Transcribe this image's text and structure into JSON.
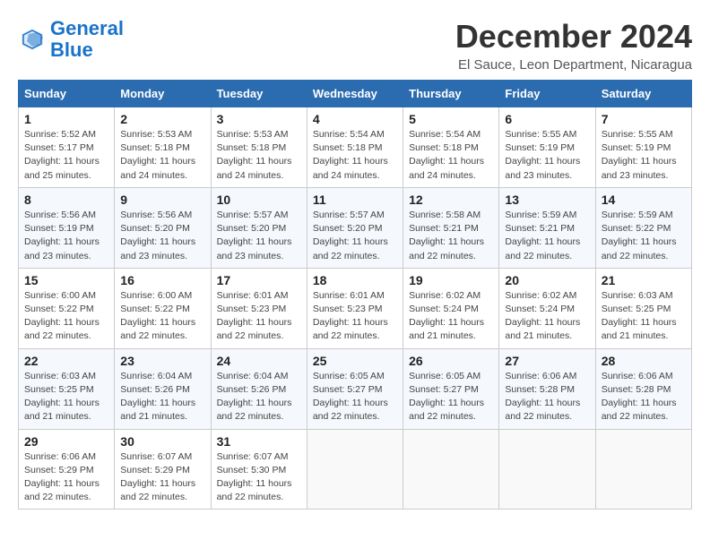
{
  "logo": {
    "line1": "General",
    "line2": "Blue"
  },
  "title": "December 2024",
  "subtitle": "El Sauce, Leon Department, Nicaragua",
  "days_of_week": [
    "Sunday",
    "Monday",
    "Tuesday",
    "Wednesday",
    "Thursday",
    "Friday",
    "Saturday"
  ],
  "weeks": [
    [
      {
        "day": "1",
        "detail": "Sunrise: 5:52 AM\nSunset: 5:17 PM\nDaylight: 11 hours\nand 25 minutes."
      },
      {
        "day": "2",
        "detail": "Sunrise: 5:53 AM\nSunset: 5:18 PM\nDaylight: 11 hours\nand 24 minutes."
      },
      {
        "day": "3",
        "detail": "Sunrise: 5:53 AM\nSunset: 5:18 PM\nDaylight: 11 hours\nand 24 minutes."
      },
      {
        "day": "4",
        "detail": "Sunrise: 5:54 AM\nSunset: 5:18 PM\nDaylight: 11 hours\nand 24 minutes."
      },
      {
        "day": "5",
        "detail": "Sunrise: 5:54 AM\nSunset: 5:18 PM\nDaylight: 11 hours\nand 24 minutes."
      },
      {
        "day": "6",
        "detail": "Sunrise: 5:55 AM\nSunset: 5:19 PM\nDaylight: 11 hours\nand 23 minutes."
      },
      {
        "day": "7",
        "detail": "Sunrise: 5:55 AM\nSunset: 5:19 PM\nDaylight: 11 hours\nand 23 minutes."
      }
    ],
    [
      {
        "day": "8",
        "detail": "Sunrise: 5:56 AM\nSunset: 5:19 PM\nDaylight: 11 hours\nand 23 minutes."
      },
      {
        "day": "9",
        "detail": "Sunrise: 5:56 AM\nSunset: 5:20 PM\nDaylight: 11 hours\nand 23 minutes."
      },
      {
        "day": "10",
        "detail": "Sunrise: 5:57 AM\nSunset: 5:20 PM\nDaylight: 11 hours\nand 23 minutes."
      },
      {
        "day": "11",
        "detail": "Sunrise: 5:57 AM\nSunset: 5:20 PM\nDaylight: 11 hours\nand 22 minutes."
      },
      {
        "day": "12",
        "detail": "Sunrise: 5:58 AM\nSunset: 5:21 PM\nDaylight: 11 hours\nand 22 minutes."
      },
      {
        "day": "13",
        "detail": "Sunrise: 5:59 AM\nSunset: 5:21 PM\nDaylight: 11 hours\nand 22 minutes."
      },
      {
        "day": "14",
        "detail": "Sunrise: 5:59 AM\nSunset: 5:22 PM\nDaylight: 11 hours\nand 22 minutes."
      }
    ],
    [
      {
        "day": "15",
        "detail": "Sunrise: 6:00 AM\nSunset: 5:22 PM\nDaylight: 11 hours\nand 22 minutes."
      },
      {
        "day": "16",
        "detail": "Sunrise: 6:00 AM\nSunset: 5:22 PM\nDaylight: 11 hours\nand 22 minutes."
      },
      {
        "day": "17",
        "detail": "Sunrise: 6:01 AM\nSunset: 5:23 PM\nDaylight: 11 hours\nand 22 minutes."
      },
      {
        "day": "18",
        "detail": "Sunrise: 6:01 AM\nSunset: 5:23 PM\nDaylight: 11 hours\nand 22 minutes."
      },
      {
        "day": "19",
        "detail": "Sunrise: 6:02 AM\nSunset: 5:24 PM\nDaylight: 11 hours\nand 21 minutes."
      },
      {
        "day": "20",
        "detail": "Sunrise: 6:02 AM\nSunset: 5:24 PM\nDaylight: 11 hours\nand 21 minutes."
      },
      {
        "day": "21",
        "detail": "Sunrise: 6:03 AM\nSunset: 5:25 PM\nDaylight: 11 hours\nand 21 minutes."
      }
    ],
    [
      {
        "day": "22",
        "detail": "Sunrise: 6:03 AM\nSunset: 5:25 PM\nDaylight: 11 hours\nand 21 minutes."
      },
      {
        "day": "23",
        "detail": "Sunrise: 6:04 AM\nSunset: 5:26 PM\nDaylight: 11 hours\nand 21 minutes."
      },
      {
        "day": "24",
        "detail": "Sunrise: 6:04 AM\nSunset: 5:26 PM\nDaylight: 11 hours\nand 22 minutes."
      },
      {
        "day": "25",
        "detail": "Sunrise: 6:05 AM\nSunset: 5:27 PM\nDaylight: 11 hours\nand 22 minutes."
      },
      {
        "day": "26",
        "detail": "Sunrise: 6:05 AM\nSunset: 5:27 PM\nDaylight: 11 hours\nand 22 minutes."
      },
      {
        "day": "27",
        "detail": "Sunrise: 6:06 AM\nSunset: 5:28 PM\nDaylight: 11 hours\nand 22 minutes."
      },
      {
        "day": "28",
        "detail": "Sunrise: 6:06 AM\nSunset: 5:28 PM\nDaylight: 11 hours\nand 22 minutes."
      }
    ],
    [
      {
        "day": "29",
        "detail": "Sunrise: 6:06 AM\nSunset: 5:29 PM\nDaylight: 11 hours\nand 22 minutes."
      },
      {
        "day": "30",
        "detail": "Sunrise: 6:07 AM\nSunset: 5:29 PM\nDaylight: 11 hours\nand 22 minutes."
      },
      {
        "day": "31",
        "detail": "Sunrise: 6:07 AM\nSunset: 5:30 PM\nDaylight: 11 hours\nand 22 minutes."
      },
      null,
      null,
      null,
      null
    ]
  ]
}
